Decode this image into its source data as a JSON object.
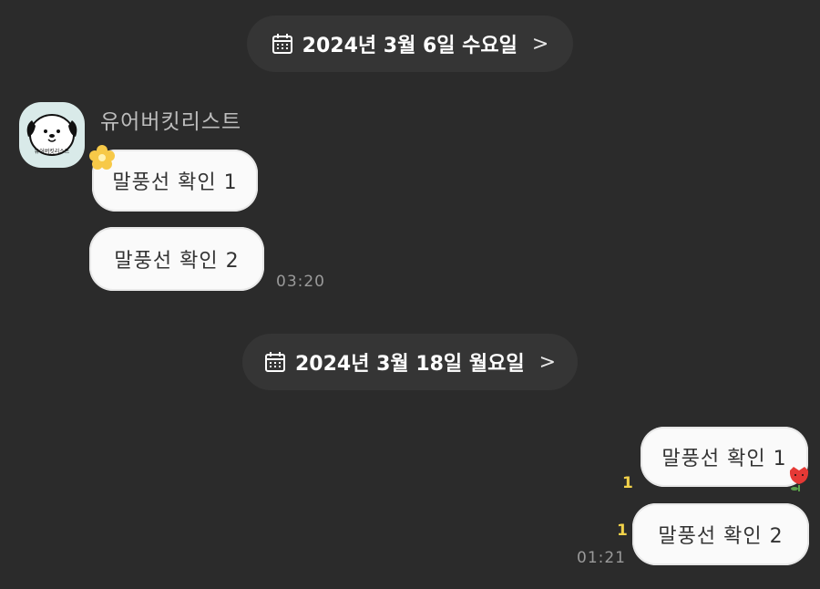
{
  "dates": [
    {
      "label": "2024년 3월 6일 수요일",
      "chevron": ">"
    },
    {
      "label": "2024년 3월 18일 월요일",
      "chevron": ">"
    }
  ],
  "sender": {
    "name": "유어버킷리스트",
    "avatar_caption": "유어버킷리스트"
  },
  "received": [
    {
      "text": "말풍선 확인 1"
    },
    {
      "text": "말풍선 확인 2",
      "time": "03:20"
    }
  ],
  "sent": [
    {
      "text": "말풍선 확인 1",
      "unread": "1"
    },
    {
      "text": "말풍선 확인 2",
      "unread": "1",
      "time": "01:21"
    }
  ],
  "colors": {
    "background": "#2b2b2b",
    "pill": "#353535",
    "bubble": "#fafafa",
    "unread": "#f2d24a",
    "time": "#9a9a9a"
  }
}
